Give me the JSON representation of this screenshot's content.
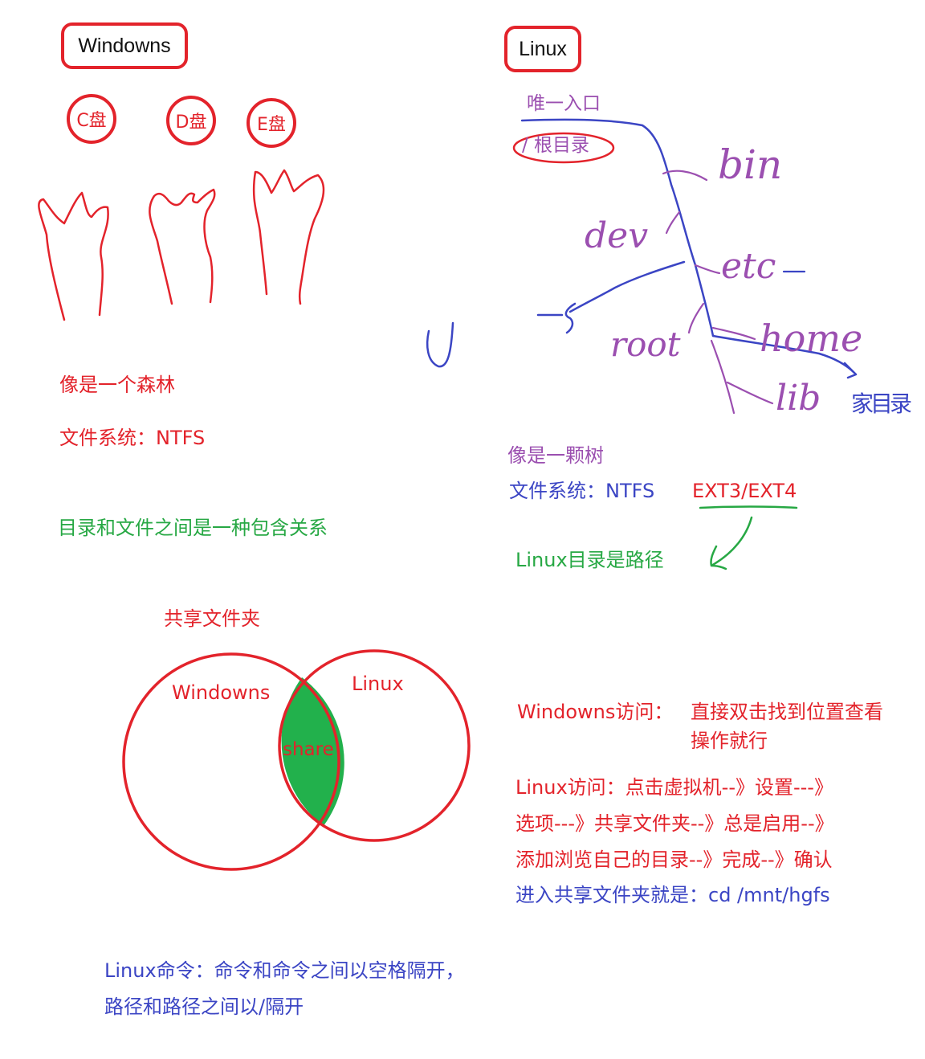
{
  "windows": {
    "title": "Windowns",
    "drives": [
      "C盘",
      "D盘",
      "E盘"
    ],
    "note_forest": "像是一个森林",
    "fs": "文件系统：NTFS",
    "relation": "目录和文件之间是一种包含关系"
  },
  "linux": {
    "title": "Linux",
    "entry": "唯一入口",
    "root": "/  根目录",
    "dirs": {
      "bin": "bin",
      "dev": "dev",
      "etc": "etc",
      "root": "root",
      "home": "home",
      "lib": "lib"
    },
    "home_note": "家目录",
    "u_mark": "U",
    "note_tree": "像是一颗树",
    "fs_label": "文件系统：NTFS",
    "fs_ext": "EXT3/EXT4",
    "path_note": "Linux目录是路径"
  },
  "share": {
    "title": "共享文件夹",
    "left": "Windowns",
    "right": "Linux",
    "middle": "share"
  },
  "access": {
    "windows_label": "Windowns访问：",
    "windows_text_1": "直接双击找到位置查看",
    "windows_text_2": "操作就行",
    "linux_line_1": "Linux访问：点击虚拟机--》设置---》",
    "linux_line_2": "选项---》共享文件夹--》总是启用--》",
    "linux_line_3": "添加浏览自己的目录--》完成--》确认",
    "linux_line_4": "进入共享文件夹就是：cd /mnt/hgfs"
  },
  "commands": {
    "line_1": "Linux命令：命令和命令之间以空格隔开，",
    "line_2": "路径和路径之间以/隔开"
  },
  "colors": {
    "red": "#e3232b",
    "green": "#27a844",
    "share_fill": "#22b14c",
    "purple": "#9b4fb0",
    "blue": "#3b45c4"
  }
}
